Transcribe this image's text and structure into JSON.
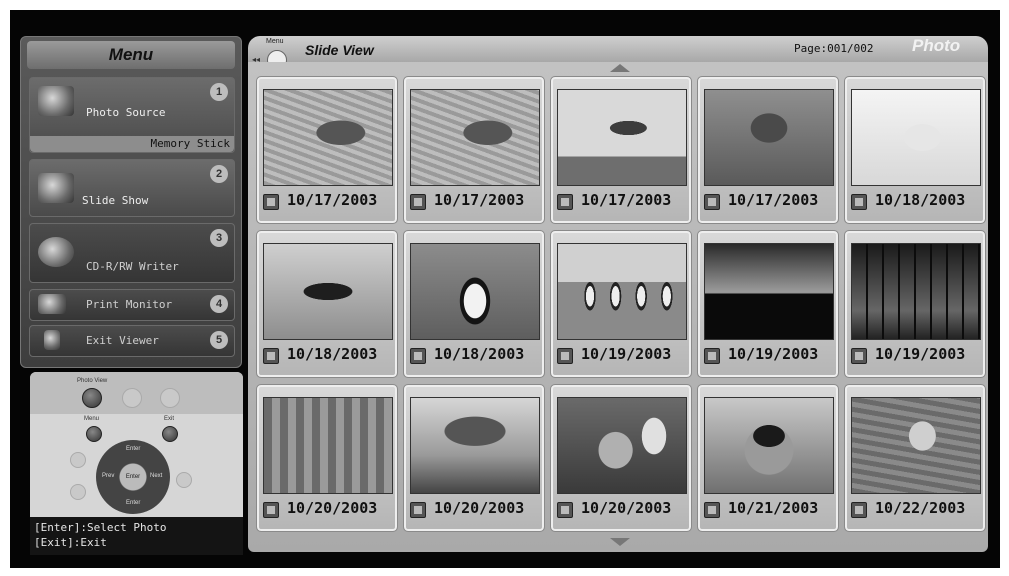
{
  "app_title": "Photo",
  "view_title": "Slide View",
  "page_indicator": "Page:001/002",
  "menu_back_label": "Menu",
  "menu": {
    "title": "Menu",
    "items": [
      {
        "label": "Photo Source",
        "number": "1",
        "sub": "Memory Stick",
        "icon": "memory-stick-icon"
      },
      {
        "label": "Slide Show",
        "number": "2",
        "icon": "slide-show-icon"
      },
      {
        "label": "CD-R/RW Writer",
        "number": "3",
        "icon": "disc-icon"
      },
      {
        "label": "Print Monitor",
        "number": "4",
        "icon": "printer-icon"
      },
      {
        "label": "Exit Viewer",
        "number": "5",
        "icon": "door-icon"
      }
    ]
  },
  "remote": {
    "photo_view_label": "Photo View",
    "menu_label": "Menu",
    "exit_label": "Exit",
    "enter_label": "Enter",
    "up_label": "Enter",
    "down_label": "Enter",
    "left_label": "Prev",
    "right_label": "Next"
  },
  "help": {
    "line1": "[Enter]:Select Photo",
    "line2": "[Exit]:Exit"
  },
  "photos": [
    {
      "date": "10/17/2003",
      "subject": "dolphin-water"
    },
    {
      "date": "10/17/2003",
      "subject": "dolphin-water"
    },
    {
      "date": "10/17/2003",
      "subject": "dolphin-jump"
    },
    {
      "date": "10/17/2003",
      "subject": "otter"
    },
    {
      "date": "10/18/2003",
      "subject": "seal-pup"
    },
    {
      "date": "10/18/2003",
      "subject": "penguin-dive"
    },
    {
      "date": "10/18/2003",
      "subject": "penguin"
    },
    {
      "date": "10/19/2003",
      "subject": "penguins"
    },
    {
      "date": "10/19/2003",
      "subject": "sunset-umbrellas"
    },
    {
      "date": "10/19/2003",
      "subject": "palm-trees"
    },
    {
      "date": "10/20/2003",
      "subject": "street"
    },
    {
      "date": "10/20/2003",
      "subject": "umbrella"
    },
    {
      "date": "10/20/2003",
      "subject": "face"
    },
    {
      "date": "10/21/2003",
      "subject": "camera-person"
    },
    {
      "date": "10/22/2003",
      "subject": "swimmer"
    }
  ],
  "colors": {
    "background": "#050505",
    "panel": "#b5b5b5",
    "menu": "#4a4a4a"
  }
}
